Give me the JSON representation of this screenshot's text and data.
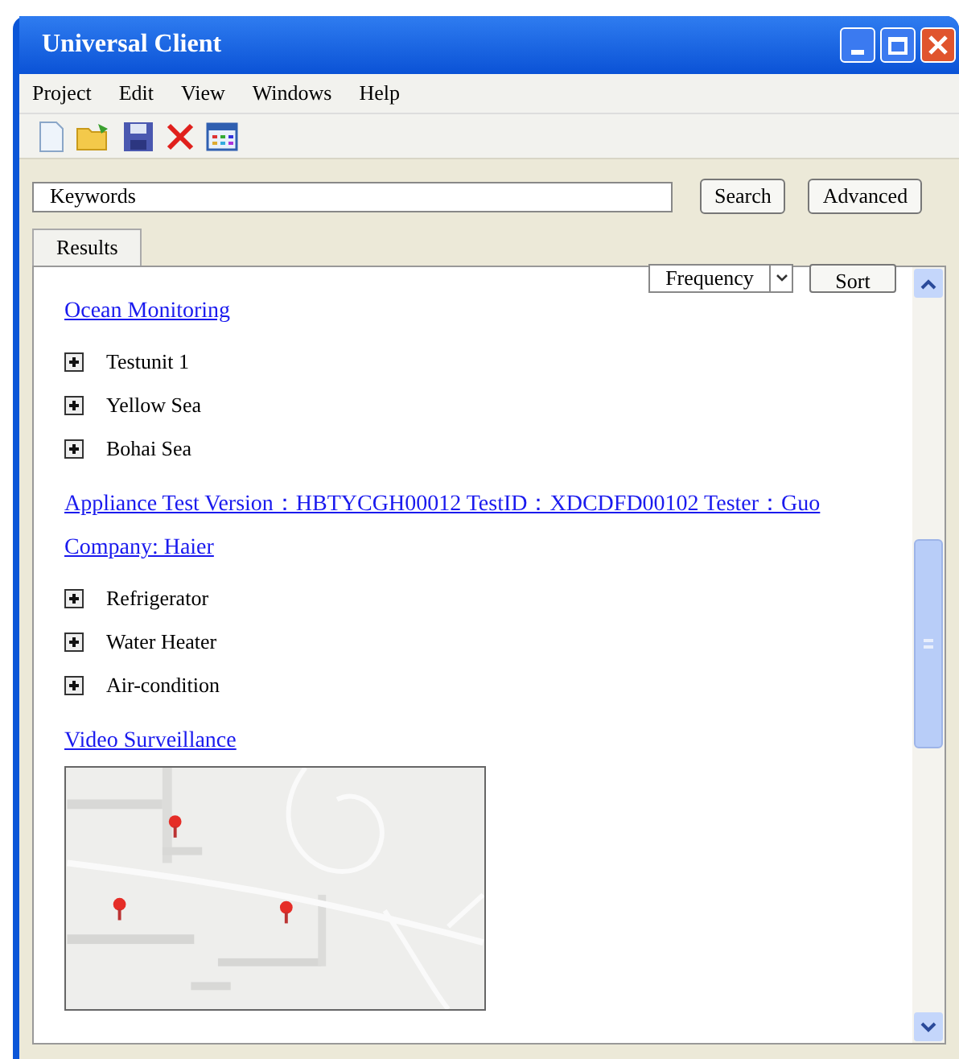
{
  "window": {
    "title": "Universal Client"
  },
  "menu": [
    "Project",
    "Edit",
    "View",
    "Windows",
    "Help"
  ],
  "search": {
    "value": "Keywords"
  },
  "buttons": [
    "Search",
    "Advanced"
  ],
  "tabs": [
    {
      "label": "Results",
      "selected": true
    }
  ],
  "sort": {
    "field": "Frequency",
    "button": "Sort"
  },
  "groups": [
    {
      "title": "Ocean Monitoring",
      "kind": "tree",
      "items": [
        {
          "label": "Testunit 1",
          "expanded": false
        },
        {
          "label": "Yellow Sea",
          "expanded": false
        },
        {
          "label": "Bohai Sea",
          "expanded": false
        }
      ]
    },
    {
      "title": "Appliance Test Version：HBTYCGH00012 TestID：XDCDFD00102 Tester：Guo Company: Haier",
      "kind": "tree",
      "items": [
        {
          "label": "Refrigerator",
          "expanded": false
        },
        {
          "label": "Water Heater",
          "expanded": false
        },
        {
          "label": "Air-condition",
          "expanded": false
        }
      ]
    },
    {
      "title": "Video Surveillance",
      "kind": "picture"
    }
  ]
}
